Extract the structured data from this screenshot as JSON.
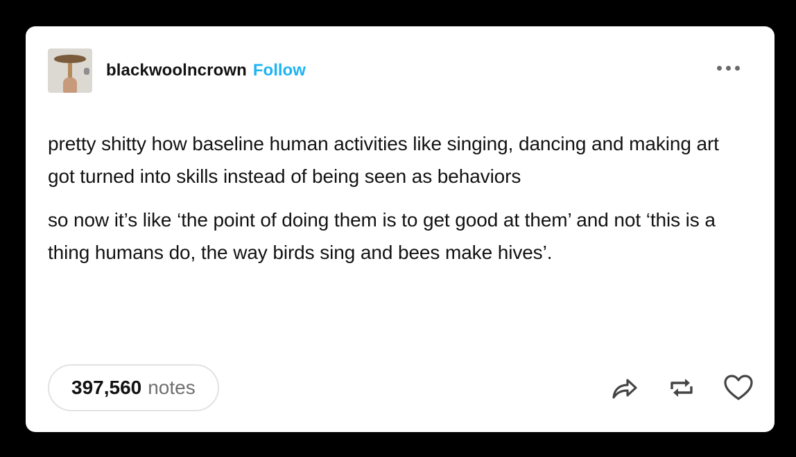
{
  "post": {
    "username": "blackwoolncrown",
    "follow_label": "Follow",
    "paragraphs": [
      "pretty shitty how baseline human activities like singing, dancing and making art got turned into skills  instead of being seen as behaviors",
      "so now it’s like ‘the point of doing them is to get good at them’ and not ‘this is a thing humans do, the way birds sing and bees make hives’."
    ],
    "notes_count": "397,560",
    "notes_label": "notes"
  },
  "icons": {
    "more": "more-options-icon",
    "share": "share-icon",
    "reblog": "reblog-icon",
    "like": "heart-icon"
  },
  "colors": {
    "background": "#000000",
    "card": "#ffffff",
    "accent": "#1db4f5",
    "text": "#121212",
    "muted": "#6f6f6f"
  }
}
